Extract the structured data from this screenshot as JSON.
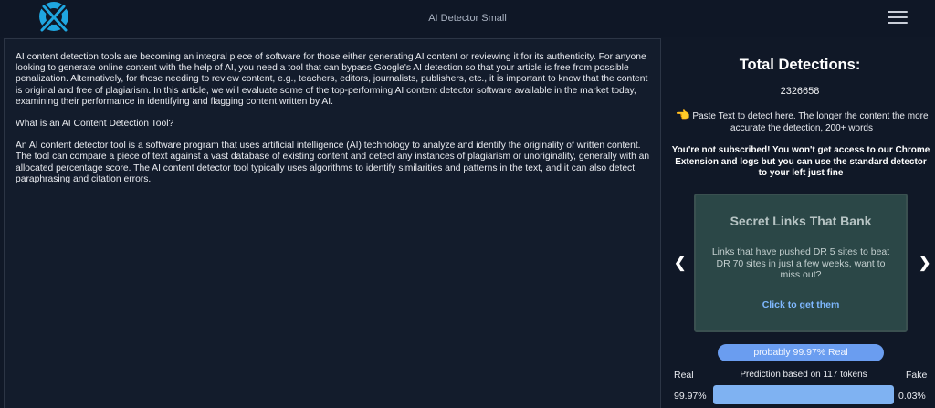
{
  "header": {
    "title": "AI Detector Small",
    "logo_icon": "x-circle-logo-icon",
    "menu_icon": "hamburger-menu-icon",
    "logo_color": "#1fa6e0"
  },
  "editor": {
    "paragraphs": [
      "AI content detection tools are becoming an integral piece of software for those either generating AI content or reviewing it for its authenticity. For anyone looking to generate online content with the help of AI, you need a tool that can bypass Google's AI detection so that your article is free from possible penalization. Alternatively, for those needing to review content, e.g., teachers, editors, journalists, publishers, etc., it is important to know that the content is original and free of plagiarism. In this article, we will evaluate some of the top-performing AI content detector software available in the market today, examining their performance in identifying and flagging content written by AI.",
      "What is an AI Content Detection Tool?",
      "An AI content detector tool is a software program that uses artificial intelligence (AI) technology to analyze and identify the originality of written content. The tool can compare a piece of text against a vast database of existing content and detect any instances of plagiarism or unoriginality, generally with an allocated percentage score. The AI content detector tool typically uses algorithms to identify similarities and patterns in the text, and it can also detect paraphrasing and citation errors."
    ]
  },
  "sidebar": {
    "total_title": "Total Detections:",
    "total_count": "2326658",
    "hint_icon": "pointing-hand-icon",
    "hint": "Paste Text to detect here. The longer the content the more accurate the detection, 200+ words",
    "notice": "You're not subscribed! You won't get access to our Chrome Extension and logs but you can use the standard detector to your left just fine",
    "prev_icon": "chevron-left-icon",
    "next_icon": "chevron-right-icon",
    "promo": {
      "title": "Secret Links That Bank",
      "body": "Links that have pushed DR 5 sites to beat DR 70 sites in just a few weeks, want to miss out?",
      "link": "Click to get them"
    },
    "result": {
      "label": "probably 99.97% Real",
      "real_label": "Real",
      "fake_label": "Fake",
      "prediction": "Prediction based on 117 tokens",
      "real_pct": "99.97%",
      "fake_pct": "0.03%",
      "real_fraction": 0.9997,
      "accent": "#7fb2f2"
    }
  }
}
